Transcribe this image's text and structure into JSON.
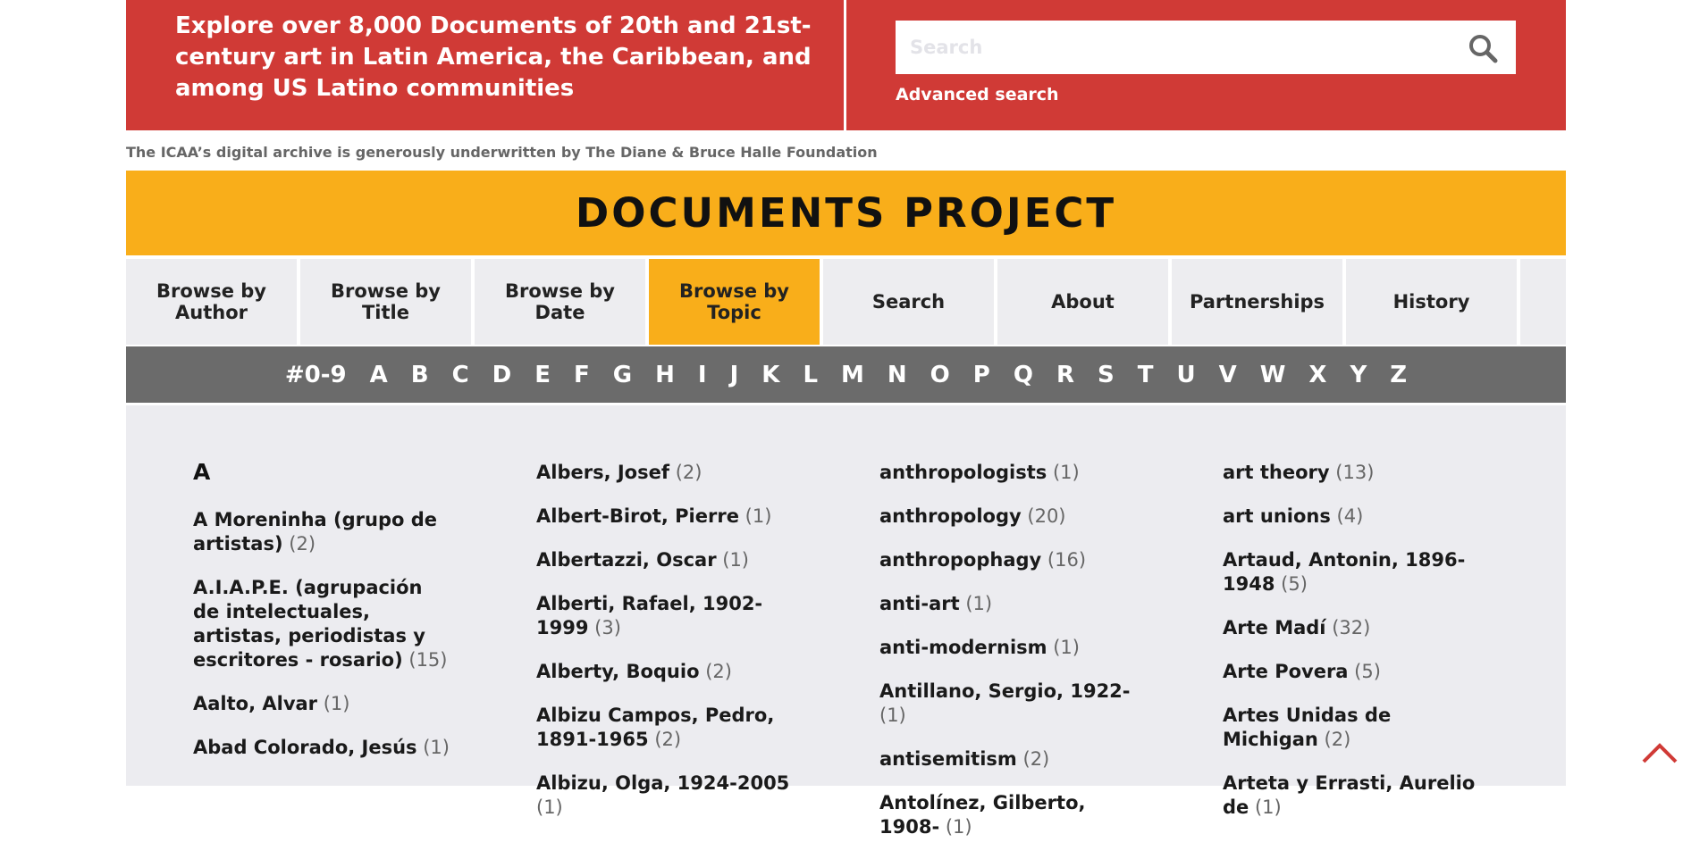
{
  "header": {
    "tagline": "Explore over 8,000 Documents of 20th and 21st-century art in Latin America, the Caribbean, and among US Latino communities",
    "search_placeholder": "Search",
    "advanced_search": "Advanced search",
    "underwriter": "The ICAA’s digital archive is generously underwritten by The Diane & Bruce Halle Foundation"
  },
  "banner": {
    "title": "DOCUMENTS PROJECT"
  },
  "nav": {
    "items": [
      {
        "label": "Browse by Author"
      },
      {
        "label": "Browse by Title"
      },
      {
        "label": "Browse by Date"
      },
      {
        "label": "Browse by Topic"
      },
      {
        "label": "Search"
      },
      {
        "label": "About"
      },
      {
        "label": "Partnerships"
      },
      {
        "label": "History"
      }
    ],
    "active_index": 3
  },
  "alphabet": [
    "#0-9",
    "A",
    "B",
    "C",
    "D",
    "E",
    "F",
    "G",
    "H",
    "I",
    "J",
    "K",
    "L",
    "M",
    "N",
    "O",
    "P",
    "Q",
    "R",
    "S",
    "T",
    "U",
    "V",
    "W",
    "X",
    "Y",
    "Z"
  ],
  "content": {
    "section_letter": "A",
    "columns": [
      [
        {
          "name": "A Moreninha (grupo de artistas)",
          "count": "(2)"
        },
        {
          "name": "A.I.A.P.E. (agrupación de intelectuales, artistas, periodistas y escritores - rosario)",
          "count": "(15)"
        },
        {
          "name": "Aalto, Alvar",
          "count": "(1)"
        },
        {
          "name": "Abad Colorado, Jesús",
          "count": "(1)"
        }
      ],
      [
        {
          "name": "Albers, Josef",
          "count": "(2)"
        },
        {
          "name": "Albert-Birot, Pierre",
          "count": "(1)"
        },
        {
          "name": "Albertazzi, Oscar",
          "count": "(1)"
        },
        {
          "name": "Alberti, Rafael, 1902-1999",
          "count": "(3)"
        },
        {
          "name": "Alberty, Boquio",
          "count": "(2)"
        },
        {
          "name": "Albizu Campos, Pedro, 1891-1965",
          "count": "(2)"
        },
        {
          "name": "Albizu, Olga, 1924-2005",
          "count": "(1)"
        }
      ],
      [
        {
          "name": "anthropologists",
          "count": "(1)"
        },
        {
          "name": "anthropology",
          "count": "(20)"
        },
        {
          "name": "anthropophagy",
          "count": "(16)"
        },
        {
          "name": "anti-art",
          "count": "(1)"
        },
        {
          "name": "anti-modernism",
          "count": "(1)"
        },
        {
          "name": "Antillano, Sergio, 1922-",
          "count": "(1)"
        },
        {
          "name": "antisemitism",
          "count": "(2)"
        },
        {
          "name": "Antolínez, Gilberto, 1908-",
          "count": "(1)"
        }
      ],
      [
        {
          "name": "art theory",
          "count": "(13)"
        },
        {
          "name": "art unions",
          "count": "(4)"
        },
        {
          "name": "Artaud, Antonin, 1896-1948",
          "count": "(5)"
        },
        {
          "name": "Arte Madí",
          "count": "(32)"
        },
        {
          "name": "Arte Povera",
          "count": "(5)"
        },
        {
          "name": "Artes Unidas de Michigan",
          "count": "(2)"
        },
        {
          "name": "Arteta y Errasti, Aurelio de",
          "count": "(1)"
        }
      ]
    ]
  },
  "colors": {
    "hero_red": "#d03a36",
    "banner_yellow": "#f9ae1a",
    "alphabet_gray": "#6b6b6b",
    "content_bg": "#ececf0"
  },
  "icons": {
    "search": "search-icon",
    "back_to_top": "chevron-up-icon"
  }
}
